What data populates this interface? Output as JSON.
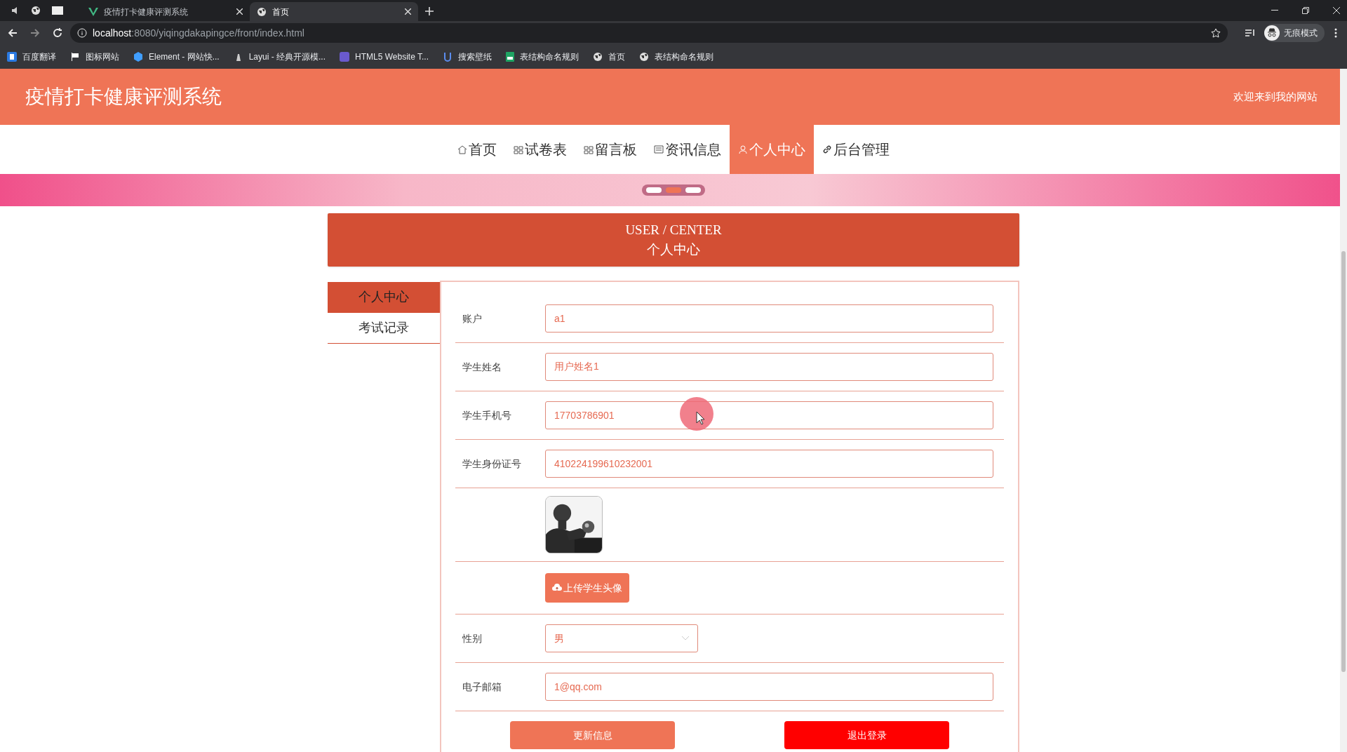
{
  "browser": {
    "tabs": [
      {
        "label": "疫情打卡健康评测系统",
        "selected": false
      },
      {
        "label": "首页",
        "selected": true
      }
    ],
    "url": {
      "host": "localhost",
      "rest": ":8080/yiqingdakapingce/front/index.html"
    },
    "bookmarks": [
      "百度翻译",
      "图标网站",
      "Element - 网站快...",
      "Layui - 经典开源模...",
      "HTML5 Website T...",
      "搜索壁纸",
      "表结构命名规则",
      "首页",
      "表结构命名规则"
    ],
    "profile": "无痕模式"
  },
  "header": {
    "title": "疫情打卡健康评测系统",
    "welcome": "欢迎来到我的网站"
  },
  "nav": [
    {
      "label": "首页",
      "selected": false
    },
    {
      "label": "试卷表",
      "selected": false
    },
    {
      "label": "留言板",
      "selected": false
    },
    {
      "label": "资讯信息",
      "selected": false
    },
    {
      "label": "个人中心",
      "selected": true
    },
    {
      "label": "后台管理",
      "selected": false
    }
  ],
  "carousel_dots": [
    {
      "selected": false
    },
    {
      "selected": true
    },
    {
      "selected": false
    }
  ],
  "section": {
    "title_en": "USER / CENTER",
    "title_cn": "个人中心"
  },
  "side_menu": [
    {
      "label": "个人中心",
      "selected": true
    },
    {
      "label": "考试记录",
      "selected": false
    }
  ],
  "form": [
    {
      "kind": "text",
      "label": "账户",
      "value": "a1"
    },
    {
      "kind": "text",
      "label": "学生姓名",
      "value": "用户姓名1"
    },
    {
      "kind": "text",
      "label": "学生手机号",
      "value": "17703786901"
    },
    {
      "kind": "text",
      "label": "学生身份证号",
      "value": "410224199610232001"
    },
    {
      "kind": "avatar"
    },
    {
      "kind": "upload",
      "button": "上传学生头像"
    },
    {
      "kind": "select",
      "label": "性别",
      "value": "男"
    },
    {
      "kind": "text",
      "label": "电子邮箱",
      "value": "1@qq.com"
    }
  ],
  "buttons": [
    {
      "label": "更新信息",
      "kind": "primary"
    },
    {
      "label": "退出登录",
      "kind": "danger"
    }
  ]
}
